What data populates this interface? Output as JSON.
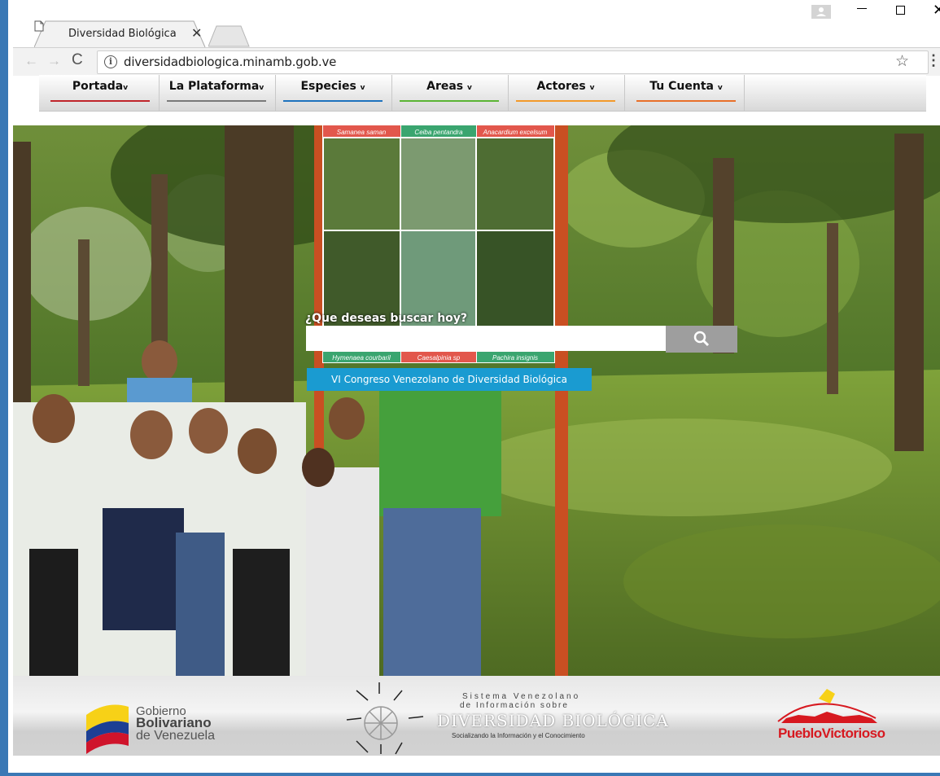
{
  "browser": {
    "tab_title": "Diversidad Biológica",
    "url": "diversidadbiologica.minamb.gob.ve"
  },
  "nav": {
    "items": [
      {
        "label": "Portada",
        "caret": "v",
        "color": "#c0252b"
      },
      {
        "label": "La Plataforma",
        "caret": "v",
        "color": "#7a7a7a"
      },
      {
        "label": "Especies",
        "caret": "v",
        "color": "#1e73be"
      },
      {
        "label": "Areas",
        "caret": "v",
        "color": "#5bb535"
      },
      {
        "label": "Actores",
        "caret": "v",
        "color": "#f39a2b"
      },
      {
        "label": "Tu Cuenta",
        "caret": "v",
        "color": "#e8702a"
      }
    ]
  },
  "hero": {
    "sign_species_top": [
      "Samanea saman",
      "Ceiba pentandra",
      "Anacardium excelsum"
    ],
    "sign_species_bottom": [
      "Hymenaea courbaril",
      "Caesalpinia sp",
      "Pachira insignis"
    ],
    "search_label": "¿Que deseas buscar hoy?",
    "search_value": "",
    "congreso_button": "VI Congreso Venezolano de Diversidad Biológica"
  },
  "footer": {
    "gobierno_line1": "Gobierno",
    "gobierno_line2": "Bolivariano",
    "gobierno_line3": "de Venezuela",
    "sistema_line1": "Sistema Venezolano",
    "sistema_line2": "de Información sobre",
    "sistema_line3": "DIVERSIDAD BIOLÓGICA",
    "sistema_line4": "Socializando la Información y el Conocimiento",
    "pueblo": "PuebloVictorioso"
  },
  "colors": {
    "accent": "#1a9bd1",
    "window_border": "#3a78b5"
  }
}
